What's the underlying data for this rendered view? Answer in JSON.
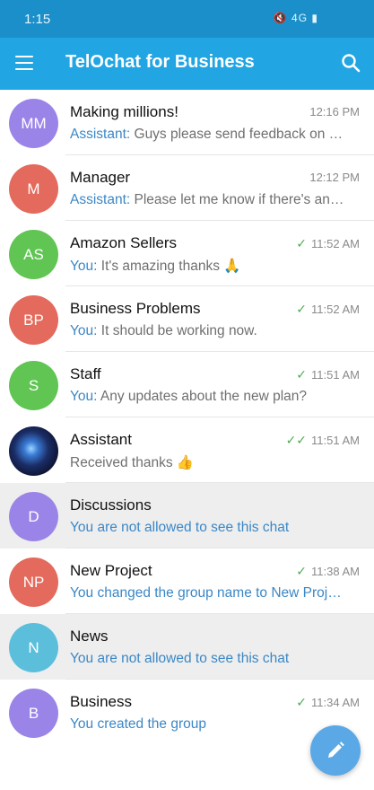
{
  "status_bar": {
    "time": "1:15",
    "indicators": "🔇 4G ▮"
  },
  "app_bar": {
    "title": "TelOchat for Business",
    "menu_icon": "hamburger-menu-icon",
    "search_icon": "search-icon"
  },
  "colors": {
    "header": "#22a5e3",
    "status_bar": "#1a8fc9",
    "link_blue": "#3b87c6",
    "check_green": "#4caf50"
  },
  "chats": [
    {
      "initials": "MM",
      "color": "#9b84e8",
      "name": "Making millions!",
      "time": "12:16 PM",
      "status": "",
      "sender": "Assistant:",
      "message": " Guys please send feedback on the latest..."
    },
    {
      "initials": "M",
      "color": "#e36a5c",
      "name": "Manager",
      "time": "12:12 PM",
      "status": "",
      "sender": "Assistant:",
      "message": " Please let me know if there's anything..."
    },
    {
      "initials": "AS",
      "color": "#61c554",
      "name": "Amazon Sellers",
      "time": "11:52 AM",
      "status": "✓",
      "sender": "You:",
      "message": " It's amazing thanks 🙏"
    },
    {
      "initials": "BP",
      "color": "#e36a5c",
      "name": "Business Problems",
      "time": "11:52 AM",
      "status": "✓",
      "sender": "You:",
      "message": " It should be working now."
    },
    {
      "initials": "S",
      "color": "#61c554",
      "name": "Staff",
      "time": "11:51 AM",
      "status": "✓",
      "sender": "You:",
      "message": " Any updates about the new plan?"
    },
    {
      "initials": "",
      "color": "#16224d",
      "name": "Assistant",
      "time": "11:51 AM",
      "status": "✓✓",
      "sender": "",
      "message": "Received thanks 👍"
    },
    {
      "initials": "D",
      "color": "#9b84e8",
      "name": "Discussions",
      "time": "",
      "status": "",
      "sender": "",
      "message": "You are not allowed to see this chat"
    },
    {
      "initials": "NP",
      "color": "#e36a5c",
      "name": "New Project",
      "time": "11:38 AM",
      "status": "✓",
      "sender": "",
      "message": "You changed the group name to New Project"
    },
    {
      "initials": "N",
      "color": "#5bbfdc",
      "name": "News",
      "time": "",
      "status": "",
      "sender": "",
      "message": "You are not allowed to see this chat"
    },
    {
      "initials": "B",
      "color": "#9b84e8",
      "name": "Business",
      "time": "11:34 AM",
      "status": "✓",
      "sender": "",
      "message": "You created the group"
    }
  ],
  "fab": {
    "icon": "pencil-icon"
  }
}
